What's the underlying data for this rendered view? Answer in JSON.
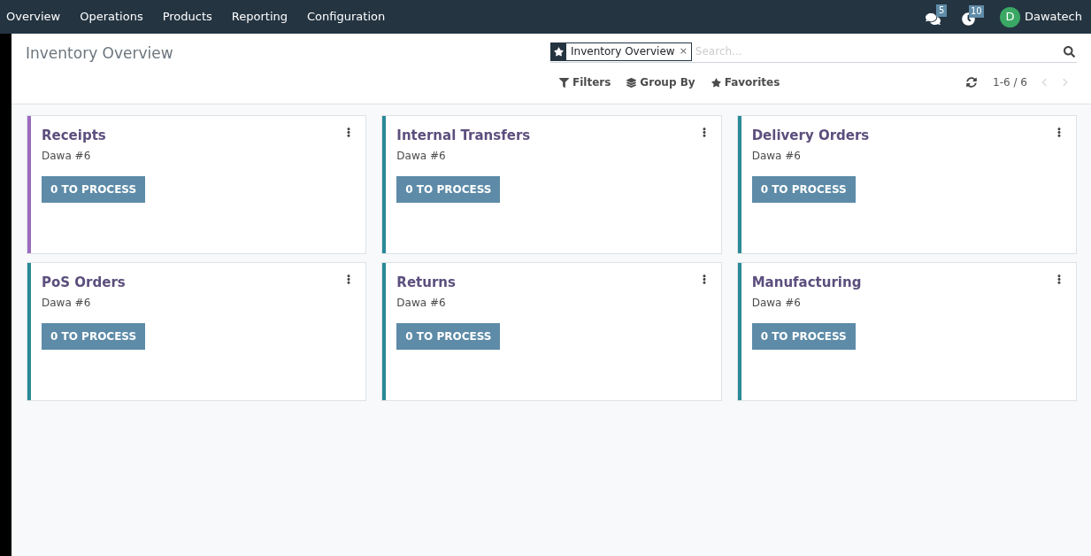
{
  "menu": [
    "Overview",
    "Operations",
    "Products",
    "Reporting",
    "Configuration"
  ],
  "systray": {
    "messages_count": "5",
    "activities_count": "10",
    "user_initial": "D",
    "user_name": "Dawatech"
  },
  "breadcrumb": "Inventory Overview",
  "search": {
    "facet": "Inventory Overview",
    "facet_remove": "×",
    "placeholder": "Search..."
  },
  "filters": [
    "Filters",
    "Group By",
    "Favorites"
  ],
  "pager": "1-6 / 6",
  "cards": [
    {
      "title": "Receipts",
      "subtitle": "Dawa #6",
      "button": "0 TO PROCESS",
      "color": "#9b6bc0"
    },
    {
      "title": "Internal Transfers",
      "subtitle": "Dawa #6",
      "button": "0 TO PROCESS",
      "color": "#2a8a97"
    },
    {
      "title": "Delivery Orders",
      "subtitle": "Dawa #6",
      "button": "0 TO PROCESS",
      "color": "#2a8a97"
    },
    {
      "title": "PoS Orders",
      "subtitle": "Dawa #6",
      "button": "0 TO PROCESS",
      "color": "#2a8a97"
    },
    {
      "title": "Returns",
      "subtitle": "Dawa #6",
      "button": "0 TO PROCESS",
      "color": "#2a8a97"
    },
    {
      "title": "Manufacturing",
      "subtitle": "Dawa #6",
      "button": "0 TO PROCESS",
      "color": "#2a8a97"
    }
  ]
}
